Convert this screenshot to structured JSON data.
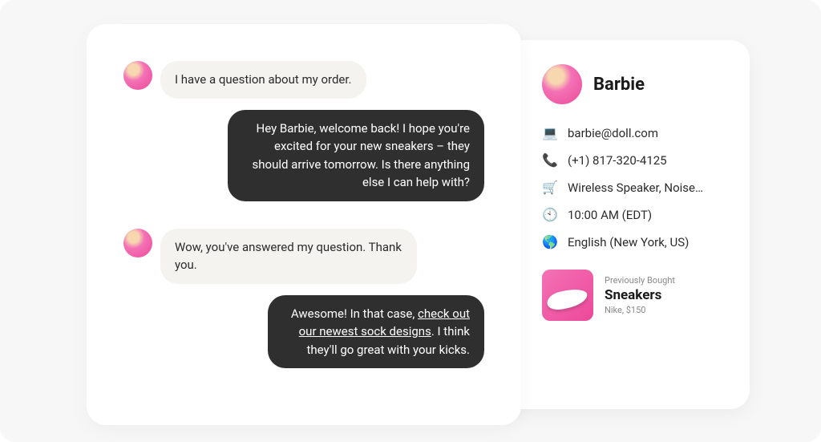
{
  "chat": {
    "messages": [
      {
        "side": "left",
        "text": "I have a question about my order."
      },
      {
        "side": "right",
        "text": "Hey Barbie, welcome back! I hope you're excited for your new sneakers – they should arrive tomorrow. Is there anything else I can help with?"
      },
      {
        "side": "left",
        "text": "Wow, you've answered my question. Thank you."
      },
      {
        "side": "right",
        "pre": "Awesome! In that case, ",
        "link": "check out our newest sock designs",
        "post": ". I think they'll go great with your kicks."
      }
    ]
  },
  "profile": {
    "name": "Barbie",
    "email": "barbie@doll.com",
    "phone": "(+1) 817-320-4125",
    "cart": "Wireless Speaker, Noise…",
    "time": "10:00 AM (EDT)",
    "locale": "English (New York, US)",
    "product": {
      "caption": "Previously Bought",
      "title": "Sneakers",
      "sub": "Nike, $150"
    }
  },
  "icons": {
    "email": "💻",
    "phone": "📞",
    "cart": "🛒",
    "time": "🕙",
    "locale": "🌎"
  }
}
